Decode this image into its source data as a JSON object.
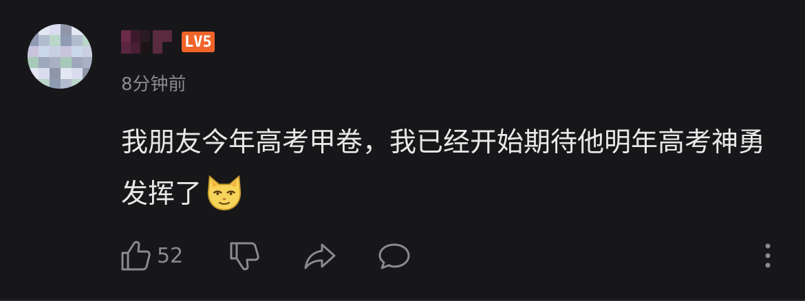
{
  "comment": {
    "author": {
      "level": "LV5",
      "level_color": "#f0642a",
      "avatar": "blurred-user-avatar"
    },
    "timestamp": "8分钟前",
    "text": "我朋友今年高考甲卷，我已经开始期待他明年高考神勇发挥了",
    "emoji": "smirking-cat-emoji"
  },
  "actions": {
    "like_icon": "thumbs-up-icon",
    "like_count": "52",
    "dislike_icon": "thumbs-down-icon",
    "share_icon": "share-arrow-icon",
    "reply_icon": "comment-bubble-icon",
    "more_icon": "more-vertical-icon"
  },
  "colors": {
    "background": "#17171a",
    "text_primary": "#e8e8e8",
    "text_secondary": "#8a8a8f",
    "icon": "#8a8a8f"
  }
}
